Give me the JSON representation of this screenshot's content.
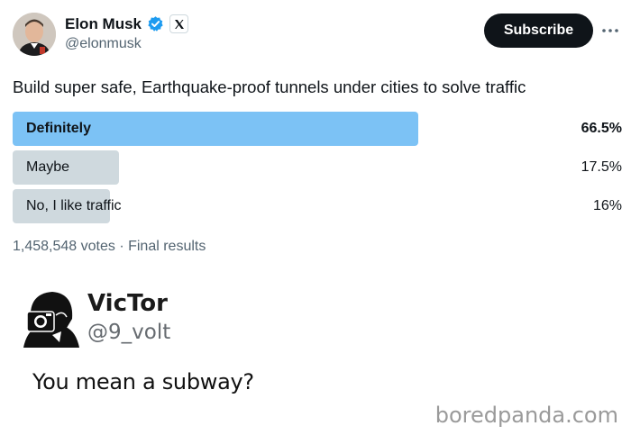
{
  "tweet": {
    "author": {
      "display_name": "Elon Musk",
      "handle": "@elonmusk",
      "verified_icon": "verified-badge-icon",
      "affiliation_icon": "x-logo-icon"
    },
    "subscribe_label": "Subscribe",
    "more_icon": "more-options-icon",
    "text": "Build super safe, Earthquake-proof tunnels under cities to solve traffic"
  },
  "poll": {
    "options": [
      {
        "label": "Definitely",
        "percent_text": "66.5%",
        "percent": 66.5,
        "winner": true
      },
      {
        "label": "Maybe",
        "percent_text": "17.5%",
        "percent": 17.5,
        "winner": false
      },
      {
        "label": "No, I like traffic",
        "percent_text": "16%",
        "percent": 16,
        "winner": false
      }
    ],
    "meta": "1,458,548 votes · Final results"
  },
  "reply": {
    "display_name": "VicTor",
    "handle": "@9_volt",
    "text": "You mean a subway?"
  },
  "watermark": "boredpanda.com",
  "colors": {
    "winner_bar": "#7cc2f5",
    "other_bar": "#cfd9de",
    "verified_blue": "#1d9bf0",
    "subscribe_bg": "#0f1419"
  }
}
